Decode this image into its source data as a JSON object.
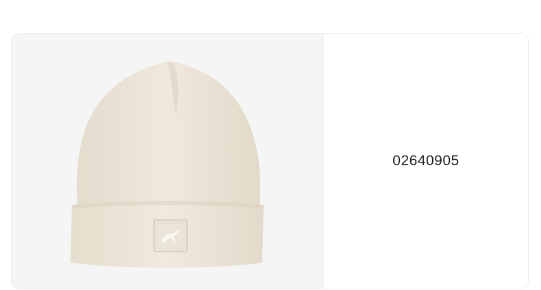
{
  "product": {
    "code": "02640905",
    "image_subject": "beanie-hat",
    "image_color": "#ece4d8",
    "logo_icon": "puma-cat-logo-icon"
  },
  "colors": {
    "image_background": "#f5f5f5",
    "card_border": "#ececec",
    "text": "#1a1a1a"
  }
}
